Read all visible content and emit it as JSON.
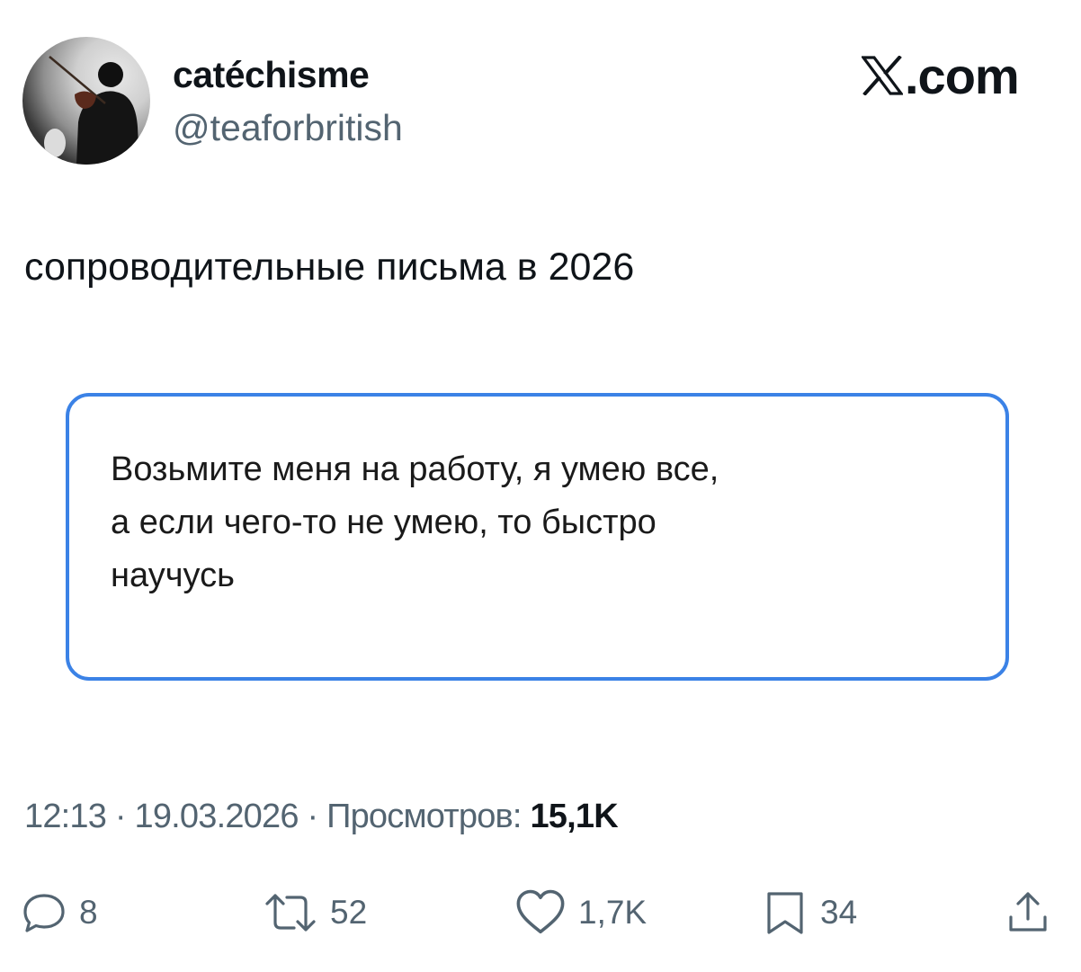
{
  "author": {
    "display_name": "catéchisme",
    "handle": "@teaforbritish"
  },
  "brand": {
    "logo_suffix": ".com",
    "logo_icon": "x-logo-icon"
  },
  "tweet": {
    "text": "сопроводительные письма в 2026",
    "card_text": "Возьмите меня на работу, я умею все,\nа если чего-то не умею, то быстро\nнаучусь",
    "card_border_color": "#3b82e6"
  },
  "meta": {
    "time": "12:13",
    "separator": "·",
    "date": "19.03.2026",
    "views_label": "Просмотров:",
    "views_count": "15,1K"
  },
  "actions": {
    "replies": {
      "icon": "reply-icon",
      "count": "8"
    },
    "reposts": {
      "icon": "repost-icon",
      "count": "52"
    },
    "likes": {
      "icon": "heart-icon",
      "count": "1,7K"
    },
    "bookmarks": {
      "icon": "bookmark-icon",
      "count": "34"
    },
    "share": {
      "icon": "share-icon"
    }
  },
  "colors": {
    "text_primary": "#0f1419",
    "text_secondary": "#536471",
    "accent": "#3b82e6"
  }
}
